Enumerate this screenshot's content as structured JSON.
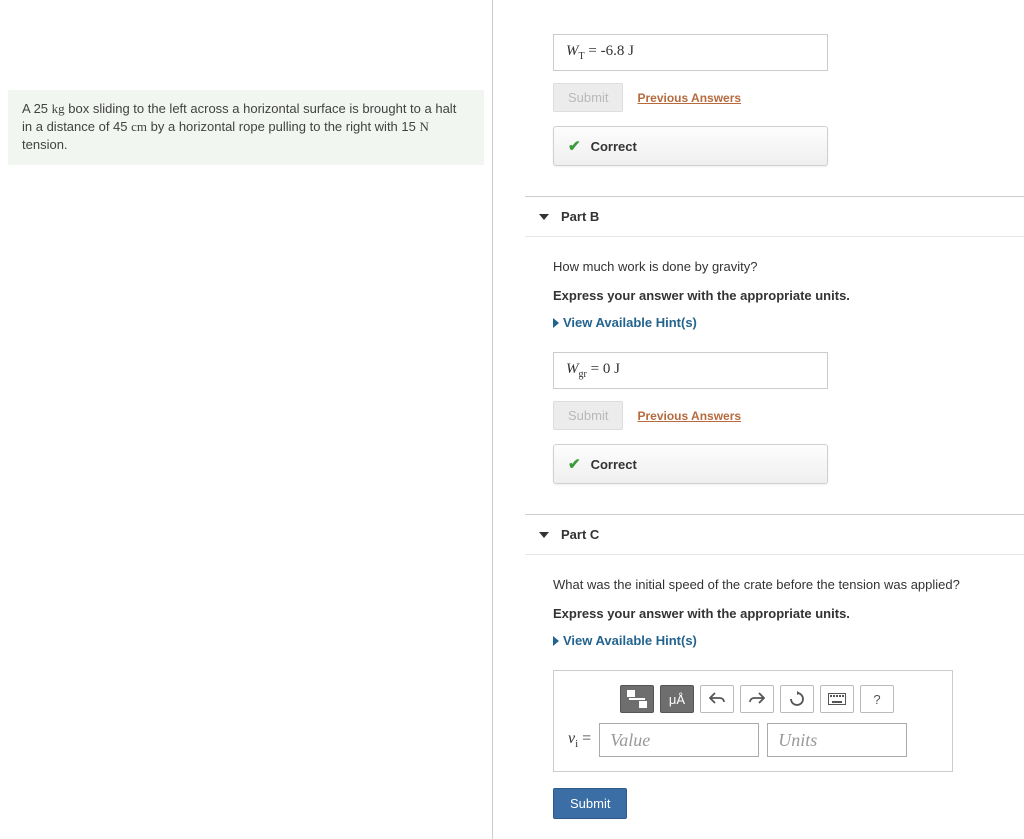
{
  "problem": {
    "text_pre": "A 25 ",
    "unit1": "kg",
    "text_mid1": " box sliding to the left across a horizontal surface is brought to a halt in a distance of 45 ",
    "unit2": "cm",
    "text_mid2": " by a horizontal rope pulling to the right with 15 ",
    "unit3": "N",
    "text_post": "  tension."
  },
  "partA": {
    "answer_var": "W",
    "answer_sub": "T",
    "answer_eq": " = ",
    "answer_val": "-6.8 J",
    "submit_label": "Submit",
    "prev_label": "Previous Answers",
    "correct_label": "Correct"
  },
  "partB": {
    "title": "Part B",
    "question": "How much work is done by gravity?",
    "instruction": "Express your answer with the appropriate units.",
    "hints": "View Available Hint(s)",
    "answer_var": "W",
    "answer_sub": "gr",
    "answer_eq": " = ",
    "answer_val": "0 J",
    "submit_label": "Submit",
    "prev_label": "Previous Answers",
    "correct_label": "Correct"
  },
  "partC": {
    "title": "Part C",
    "question": "What was the initial speed of the crate before the tension was applied?",
    "instruction": "Express your answer with the appropriate units.",
    "hints": "View Available Hint(s)",
    "toolbar": {
      "units_symbol": "μÅ",
      "help": "?"
    },
    "var_label": "v",
    "var_sub": "i",
    "var_eq": " =",
    "value_placeholder": "Value",
    "units_placeholder": "Units",
    "submit_label": "Submit"
  }
}
